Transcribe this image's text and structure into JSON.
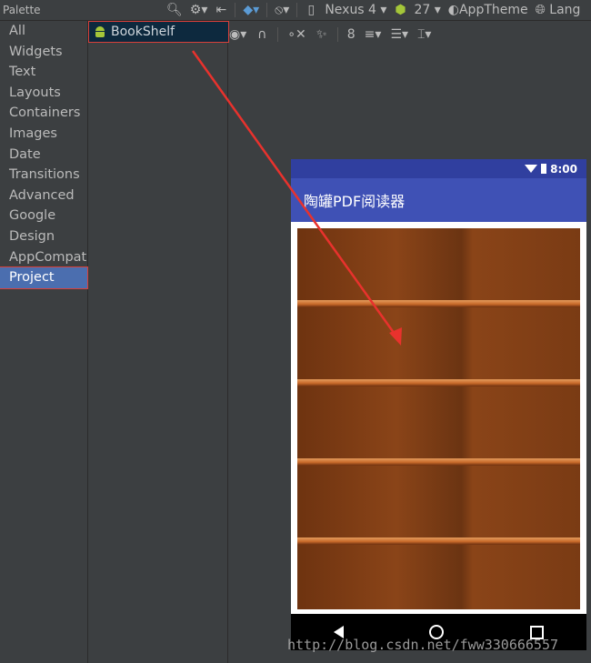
{
  "palette": {
    "title": "Palette",
    "categories": [
      "All",
      "Widgets",
      "Text",
      "Layouts",
      "Containers",
      "Images",
      "Date",
      "Transitions",
      "Advanced",
      "Google",
      "Design",
      "AppCompat",
      "Project"
    ],
    "selected_index": 12,
    "components": [
      {
        "label": "BookShelf",
        "icon": "android-icon"
      }
    ]
  },
  "toolbar": {
    "device": "Nexus 4",
    "api_level": "27",
    "theme": "AppTheme",
    "language": "Lang",
    "zoom_value": "8"
  },
  "phone": {
    "status_time": "8:00",
    "app_title": "陶罐PDF阅读器",
    "status_bar_color": "#303f9f",
    "app_bar_color": "#3f51b5"
  },
  "watermark": "http://blog.csdn.net/fww330666557"
}
